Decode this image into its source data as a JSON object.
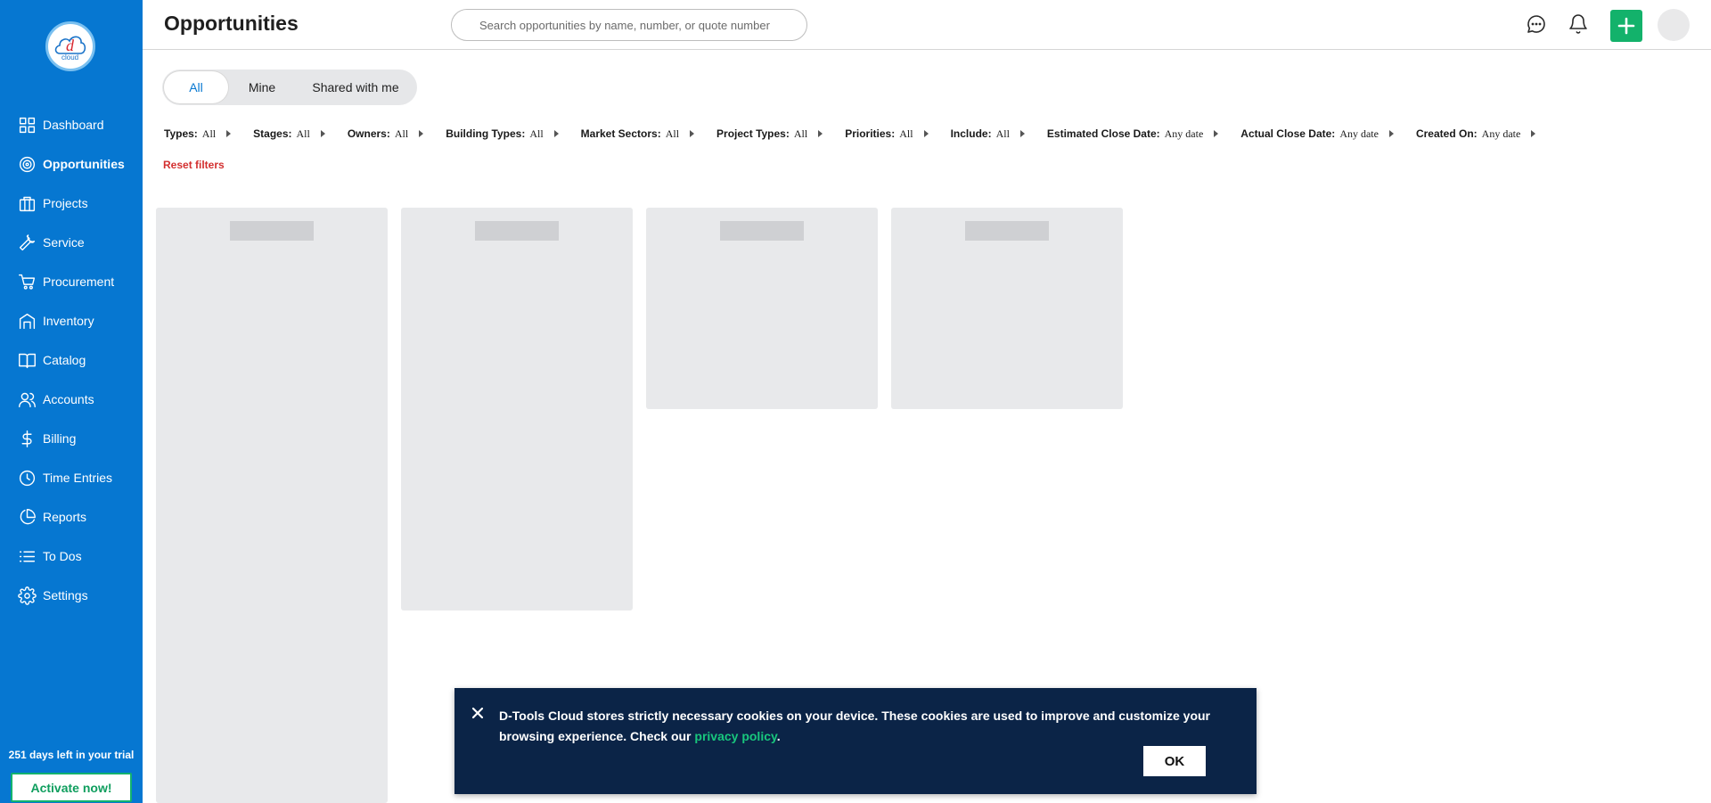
{
  "app": {
    "brand_color": "#0677d1",
    "accent_green": "#13b26b",
    "logo_icon": "d-tools-cloud-logo"
  },
  "sidebar": {
    "items": [
      {
        "label": "Dashboard",
        "icon": "dashboard-icon"
      },
      {
        "label": "Opportunities",
        "icon": "target-icon",
        "active": true
      },
      {
        "label": "Projects",
        "icon": "briefcase-icon"
      },
      {
        "label": "Service",
        "icon": "wrench-icon"
      },
      {
        "label": "Procurement",
        "icon": "cart-icon"
      },
      {
        "label": "Inventory",
        "icon": "warehouse-icon"
      },
      {
        "label": "Catalog",
        "icon": "book-icon"
      },
      {
        "label": "Accounts",
        "icon": "users-icon"
      },
      {
        "label": "Billing",
        "icon": "dollar-icon"
      },
      {
        "label": "Time Entries",
        "icon": "clock-icon"
      },
      {
        "label": "Reports",
        "icon": "pie-chart-icon"
      },
      {
        "label": "To Dos",
        "icon": "list-icon"
      },
      {
        "label": "Settings",
        "icon": "gear-icon"
      }
    ],
    "trial_text": "251 days left in your trial",
    "activate_label": "Activate now!"
  },
  "header": {
    "title": "Opportunities",
    "search_placeholder": "Search opportunities by name, number, or quote number",
    "icons": [
      "chat-icon",
      "bell-icon",
      "plus-icon",
      "avatar"
    ]
  },
  "tabs": [
    {
      "label": "All",
      "active": true
    },
    {
      "label": "Mine",
      "active": false
    },
    {
      "label": "Shared with me",
      "active": false
    }
  ],
  "filters": [
    {
      "label": "Types:",
      "value": "All"
    },
    {
      "label": "Stages:",
      "value": "All"
    },
    {
      "label": "Owners:",
      "value": "All"
    },
    {
      "label": "Building Types:",
      "value": "All"
    },
    {
      "label": "Market Sectors:",
      "value": "All"
    },
    {
      "label": "Project Types:",
      "value": "All"
    },
    {
      "label": "Priorities:",
      "value": "All"
    },
    {
      "label": "Include:",
      "value": "All"
    },
    {
      "label": "Estimated Close Date:",
      "value": "Any date"
    },
    {
      "label": "Actual Close Date:",
      "value": "Any date"
    },
    {
      "label": "Created On:",
      "value": "Any date"
    }
  ],
  "reset_filters_label": "Reset filters",
  "cookie": {
    "text_before": "D-Tools Cloud stores strictly necessary cookies on your device. These cookies are used to improve and customize your browsing experience. Check our ",
    "link_label": "privacy policy",
    "text_after": ".",
    "ok_label": "OK"
  }
}
